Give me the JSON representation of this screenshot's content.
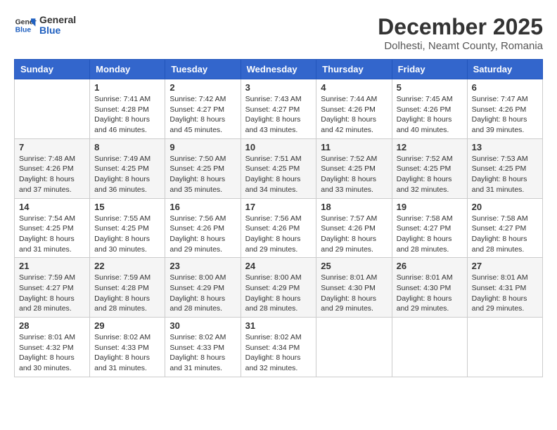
{
  "header": {
    "logo": {
      "general": "General",
      "blue": "Blue"
    },
    "month_title": "December 2025",
    "subtitle": "Dolhesti, Neamt County, Romania"
  },
  "weekdays": [
    "Sunday",
    "Monday",
    "Tuesday",
    "Wednesday",
    "Thursday",
    "Friday",
    "Saturday"
  ],
  "weeks": [
    [
      {
        "day": "",
        "info": ""
      },
      {
        "day": "1",
        "info": "Sunrise: 7:41 AM\nSunset: 4:28 PM\nDaylight: 8 hours\nand 46 minutes."
      },
      {
        "day": "2",
        "info": "Sunrise: 7:42 AM\nSunset: 4:27 PM\nDaylight: 8 hours\nand 45 minutes."
      },
      {
        "day": "3",
        "info": "Sunrise: 7:43 AM\nSunset: 4:27 PM\nDaylight: 8 hours\nand 43 minutes."
      },
      {
        "day": "4",
        "info": "Sunrise: 7:44 AM\nSunset: 4:26 PM\nDaylight: 8 hours\nand 42 minutes."
      },
      {
        "day": "5",
        "info": "Sunrise: 7:45 AM\nSunset: 4:26 PM\nDaylight: 8 hours\nand 40 minutes."
      },
      {
        "day": "6",
        "info": "Sunrise: 7:47 AM\nSunset: 4:26 PM\nDaylight: 8 hours\nand 39 minutes."
      }
    ],
    [
      {
        "day": "7",
        "info": "Sunrise: 7:48 AM\nSunset: 4:26 PM\nDaylight: 8 hours\nand 37 minutes."
      },
      {
        "day": "8",
        "info": "Sunrise: 7:49 AM\nSunset: 4:25 PM\nDaylight: 8 hours\nand 36 minutes."
      },
      {
        "day": "9",
        "info": "Sunrise: 7:50 AM\nSunset: 4:25 PM\nDaylight: 8 hours\nand 35 minutes."
      },
      {
        "day": "10",
        "info": "Sunrise: 7:51 AM\nSunset: 4:25 PM\nDaylight: 8 hours\nand 34 minutes."
      },
      {
        "day": "11",
        "info": "Sunrise: 7:52 AM\nSunset: 4:25 PM\nDaylight: 8 hours\nand 33 minutes."
      },
      {
        "day": "12",
        "info": "Sunrise: 7:52 AM\nSunset: 4:25 PM\nDaylight: 8 hours\nand 32 minutes."
      },
      {
        "day": "13",
        "info": "Sunrise: 7:53 AM\nSunset: 4:25 PM\nDaylight: 8 hours\nand 31 minutes."
      }
    ],
    [
      {
        "day": "14",
        "info": "Sunrise: 7:54 AM\nSunset: 4:25 PM\nDaylight: 8 hours\nand 31 minutes."
      },
      {
        "day": "15",
        "info": "Sunrise: 7:55 AM\nSunset: 4:25 PM\nDaylight: 8 hours\nand 30 minutes."
      },
      {
        "day": "16",
        "info": "Sunrise: 7:56 AM\nSunset: 4:26 PM\nDaylight: 8 hours\nand 29 minutes."
      },
      {
        "day": "17",
        "info": "Sunrise: 7:56 AM\nSunset: 4:26 PM\nDaylight: 8 hours\nand 29 minutes."
      },
      {
        "day": "18",
        "info": "Sunrise: 7:57 AM\nSunset: 4:26 PM\nDaylight: 8 hours\nand 29 minutes."
      },
      {
        "day": "19",
        "info": "Sunrise: 7:58 AM\nSunset: 4:27 PM\nDaylight: 8 hours\nand 28 minutes."
      },
      {
        "day": "20",
        "info": "Sunrise: 7:58 AM\nSunset: 4:27 PM\nDaylight: 8 hours\nand 28 minutes."
      }
    ],
    [
      {
        "day": "21",
        "info": "Sunrise: 7:59 AM\nSunset: 4:27 PM\nDaylight: 8 hours\nand 28 minutes."
      },
      {
        "day": "22",
        "info": "Sunrise: 7:59 AM\nSunset: 4:28 PM\nDaylight: 8 hours\nand 28 minutes."
      },
      {
        "day": "23",
        "info": "Sunrise: 8:00 AM\nSunset: 4:29 PM\nDaylight: 8 hours\nand 28 minutes."
      },
      {
        "day": "24",
        "info": "Sunrise: 8:00 AM\nSunset: 4:29 PM\nDaylight: 8 hours\nand 28 minutes."
      },
      {
        "day": "25",
        "info": "Sunrise: 8:01 AM\nSunset: 4:30 PM\nDaylight: 8 hours\nand 29 minutes."
      },
      {
        "day": "26",
        "info": "Sunrise: 8:01 AM\nSunset: 4:30 PM\nDaylight: 8 hours\nand 29 minutes."
      },
      {
        "day": "27",
        "info": "Sunrise: 8:01 AM\nSunset: 4:31 PM\nDaylight: 8 hours\nand 29 minutes."
      }
    ],
    [
      {
        "day": "28",
        "info": "Sunrise: 8:01 AM\nSunset: 4:32 PM\nDaylight: 8 hours\nand 30 minutes."
      },
      {
        "day": "29",
        "info": "Sunrise: 8:02 AM\nSunset: 4:33 PM\nDaylight: 8 hours\nand 31 minutes."
      },
      {
        "day": "30",
        "info": "Sunrise: 8:02 AM\nSunset: 4:33 PM\nDaylight: 8 hours\nand 31 minutes."
      },
      {
        "day": "31",
        "info": "Sunrise: 8:02 AM\nSunset: 4:34 PM\nDaylight: 8 hours\nand 32 minutes."
      },
      {
        "day": "",
        "info": ""
      },
      {
        "day": "",
        "info": ""
      },
      {
        "day": "",
        "info": ""
      }
    ]
  ]
}
